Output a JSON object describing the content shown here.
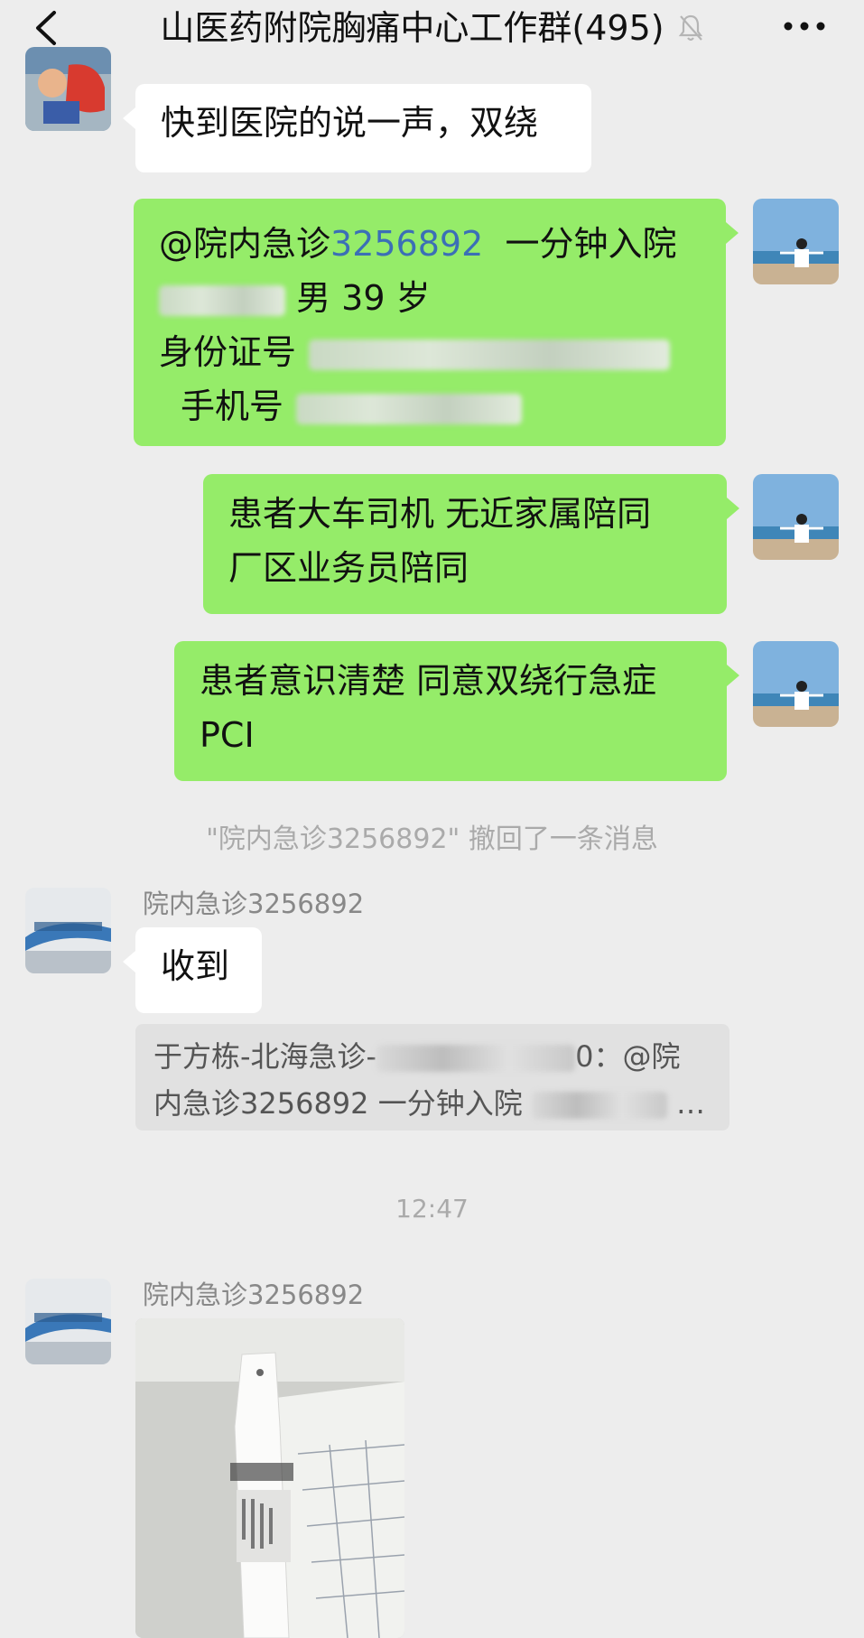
{
  "header": {
    "title": "山医药附院胸痛中心工作群(495)",
    "icons": [
      "back-icon",
      "mute-bell-icon",
      "more-icon"
    ]
  },
  "messages": {
    "m1": {
      "text": "快到医院的说一声，双绕"
    },
    "m2": {
      "mention": "@院内急诊",
      "mention_number": "3256892",
      "mention_rest": "一分钟入院",
      "line2": "男  39 岁",
      "line3_label": "身份证号",
      "line4_label": "手机号"
    },
    "m3": {
      "line1": "患者大车司机   无近家属陪同",
      "line2": "厂区业务员陪同"
    },
    "m4": {
      "line1": "患者意识清楚  同意双绕行急症",
      "line2": "PCI"
    },
    "recall": "\"院内急诊3256892\" 撤回了一条消息",
    "m5": {
      "sender": "院内急诊3256892",
      "text": "收到",
      "quote_line1_a": "于方栋-北海急诊-",
      "quote_line1_b": "0：@院",
      "quote_line2": "内急诊3256892  一分钟入院",
      "quote_ellipsis": "…"
    },
    "time": "12:47",
    "m6": {
      "sender": "院内急诊3256892",
      "photo": "wristband-photo"
    }
  },
  "colors": {
    "background": "#ededed",
    "bubble_self": "#95ec69",
    "bubble_other": "#ffffff",
    "mention_link": "#3b6fb6"
  }
}
